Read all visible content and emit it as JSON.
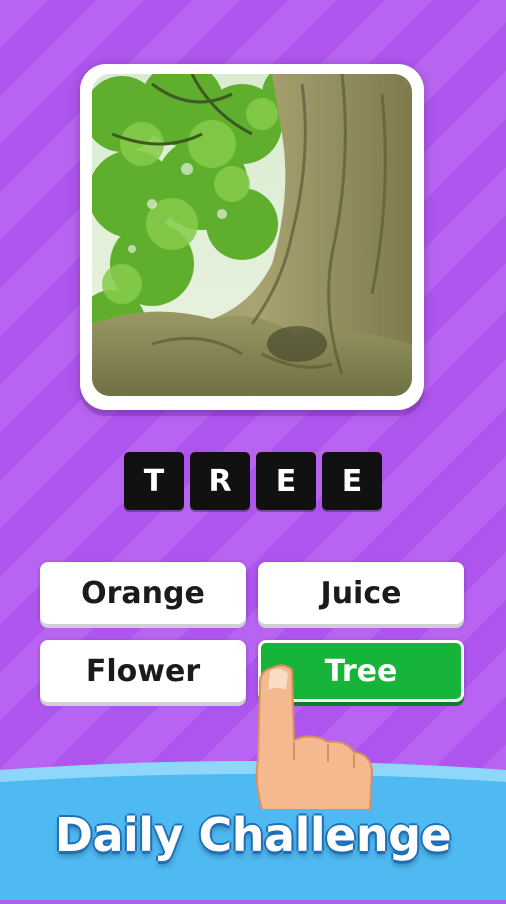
{
  "puzzle": {
    "image_subject": "tree",
    "answer_tiles": [
      "T",
      "R",
      "E",
      "E"
    ]
  },
  "options": [
    {
      "label": "Orange",
      "state": "default"
    },
    {
      "label": "Juice",
      "state": "default"
    },
    {
      "label": "Flower",
      "state": "default"
    },
    {
      "label": "Tree",
      "state": "correct"
    }
  ],
  "banner": {
    "title": "Daily Challenge"
  },
  "colors": {
    "background": "#b45cf0",
    "correct": "#17b43a",
    "tile": "#111111",
    "banner": "#4fb9f2"
  },
  "icons": {
    "hand": "pointing-hand-icon"
  }
}
